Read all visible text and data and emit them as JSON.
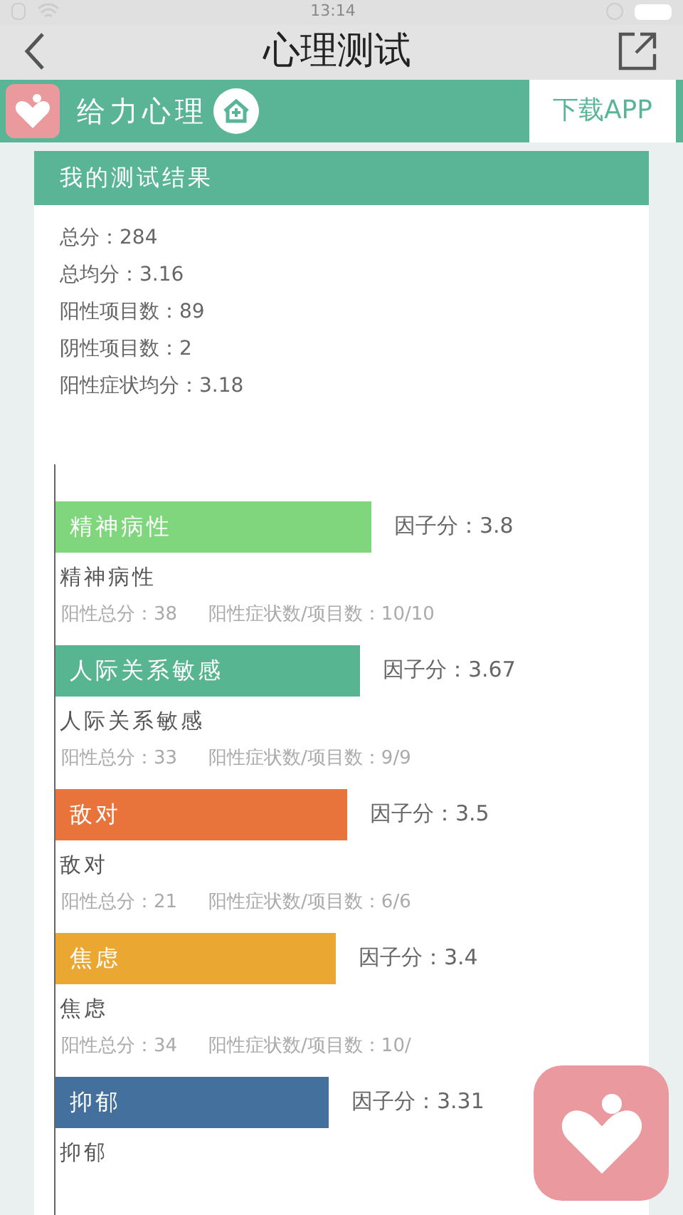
{
  "status_bar": {
    "time": "13:14"
  },
  "header": {
    "title": "心理测试"
  },
  "banner": {
    "brand": "给力心理",
    "download": "下载APP"
  },
  "card": {
    "title": "我的测试结果",
    "stats": [
      "总分：284",
      "总均分：3.16",
      "阳性项目数：89",
      "阴性项目数：2",
      "阳性症状均分：3.18"
    ],
    "factors": [
      {
        "name": "精神病性",
        "bar_label": "精神病性",
        "score": "因子分：3.8",
        "total": "阳性总分：38",
        "ratio": "阳性症状数/项目数：10/10",
        "color": "#80d67c"
      },
      {
        "name": "人际关系敏感",
        "bar_label": "人际关系敏感",
        "score": "因子分：3.67",
        "total": "阳性总分：33",
        "ratio": "阳性症状数/项目数：9/9",
        "color": "#57b592"
      },
      {
        "name": "敌对",
        "bar_label": "敌对",
        "score": "因子分：3.5",
        "total": "阳性总分：21",
        "ratio": "阳性症状数/项目数：6/6",
        "color": "#e8743b"
      },
      {
        "name": "焦虑",
        "bar_label": "焦虑",
        "score": "因子分：3.4",
        "total": "阳性总分：34",
        "ratio": "阳性症状数/项目数：10/",
        "color": "#eaa731"
      },
      {
        "name": "抑郁",
        "bar_label": "抑郁",
        "score": "因子分：3.31",
        "color": "#44709e"
      }
    ]
  }
}
